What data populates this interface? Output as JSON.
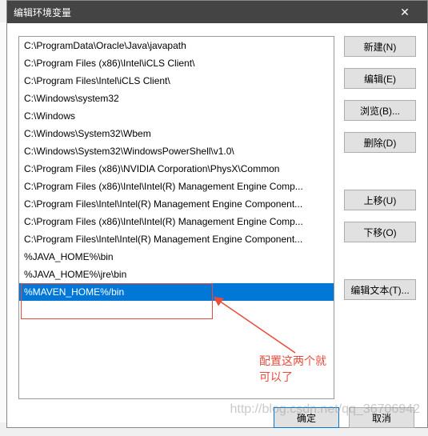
{
  "title": "编辑环境变量",
  "close_label": "✕",
  "items": [
    "C:\\ProgramData\\Oracle\\Java\\javapath",
    "C:\\Program Files (x86)\\Intel\\iCLS Client\\",
    "C:\\Program Files\\Intel\\iCLS Client\\",
    "C:\\Windows\\system32",
    "C:\\Windows",
    "C:\\Windows\\System32\\Wbem",
    "C:\\Windows\\System32\\WindowsPowerShell\\v1.0\\",
    "C:\\Program Files (x86)\\NVIDIA Corporation\\PhysX\\Common",
    "C:\\Program Files (x86)\\Intel\\Intel(R) Management Engine Comp...",
    "C:\\Program Files\\Intel\\Intel(R) Management Engine Component...",
    "C:\\Program Files (x86)\\Intel\\Intel(R) Management Engine Comp...",
    "C:\\Program Files\\Intel\\Intel(R) Management Engine Component...",
    "%JAVA_HOME%\\bin",
    "%JAVA_HOME%\\jre\\bin",
    "%MAVEN_HOME%/bin"
  ],
  "selected_index": 14,
  "buttons": {
    "new": "新建(N)",
    "edit": "编辑(E)",
    "browse": "浏览(B)...",
    "delete": "删除(D)",
    "up": "上移(U)",
    "down": "下移(O)",
    "edit_text": "编辑文本(T)..."
  },
  "footer": {
    "ok": "确定",
    "cancel": "取消"
  },
  "annotation": "配置这两个就可以了",
  "watermark": "http://blog.csdn.net/qq_36706942"
}
